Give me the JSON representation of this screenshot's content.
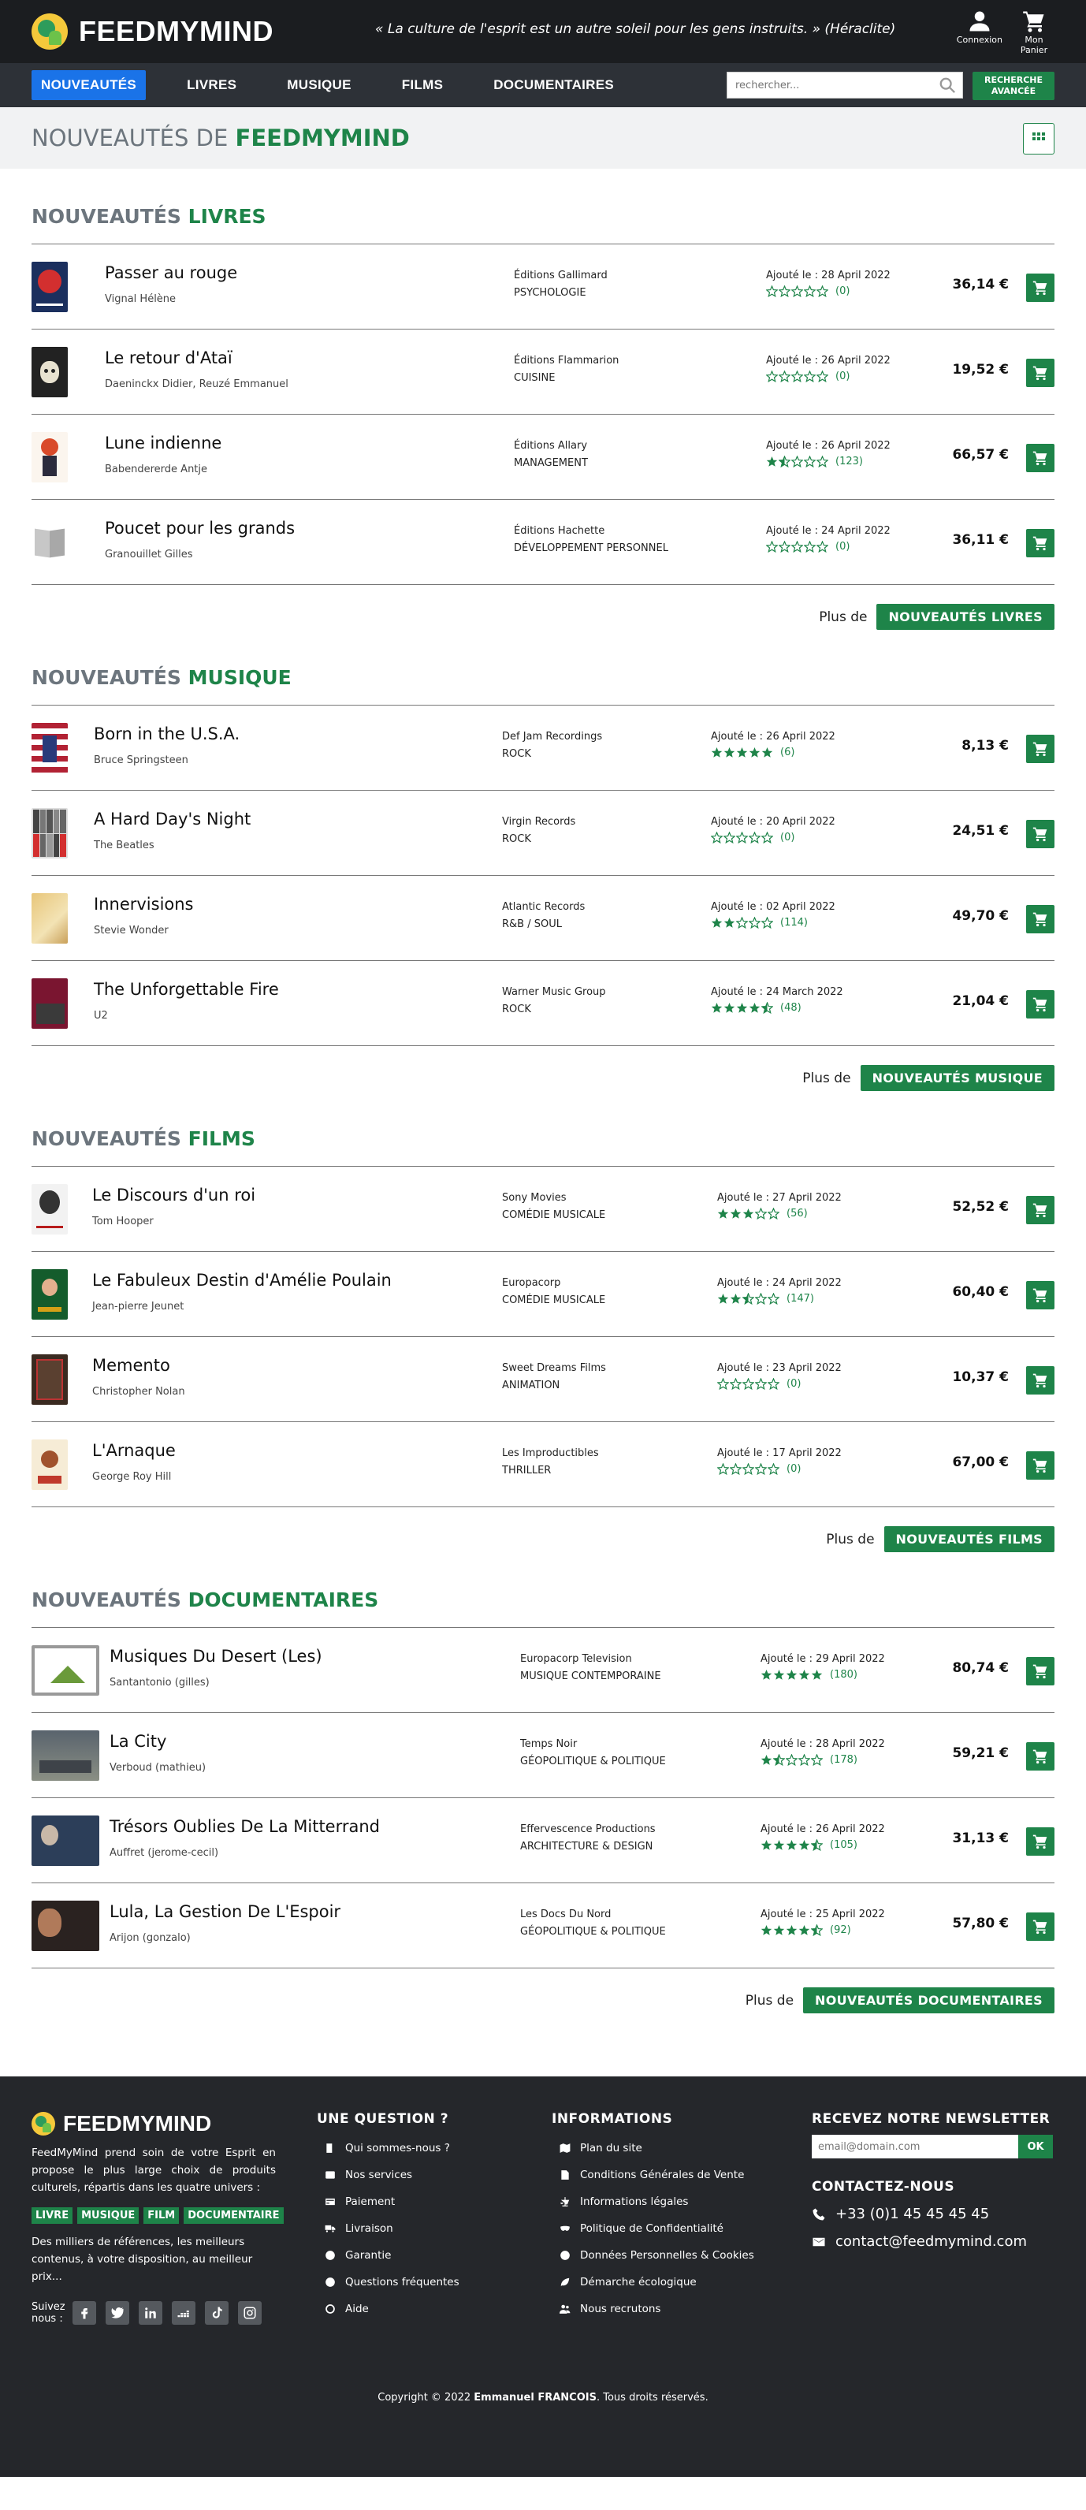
{
  "header": {
    "brand": "FEEDMYMIND",
    "quote": "« La culture de l'esprit est un autre soleil pour les gens instruits. » (Héraclite)",
    "login_label": "Connexion",
    "cart_label": "Mon Panier"
  },
  "nav": {
    "items": [
      {
        "label": "NOUVEAUTÉS",
        "active": true
      },
      {
        "label": "LIVRES"
      },
      {
        "label": "MUSIQUE"
      },
      {
        "label": "FILMS"
      },
      {
        "label": "DOCUMENTAIRES"
      }
    ],
    "search_placeholder": "rechercher...",
    "advanced_label": "RECHERCHE AVANCÉE"
  },
  "page": {
    "title_prefix": "NOUVEAUTÉS DE",
    "title_brand": "FEEDMYMIND"
  },
  "colors": {
    "accent": "#1e8449",
    "nav_active": "#1a73e8",
    "topbar": "#1b1d20"
  },
  "sections": [
    {
      "prefix": "NOUVEAUTÉS",
      "name": "LIVRES",
      "more_label": "Plus de",
      "more_button": "NOUVEAUTÉS LIVRES",
      "items": [
        {
          "title": "Passer au rouge",
          "author": "Vignal Hélène",
          "publisher": "Éditions Gallimard",
          "category": "PSYCHOLOGIE",
          "date": "Ajouté le : 28 April 2022",
          "rating": 0,
          "count": "(0)",
          "price": "36,14 €",
          "thumb": "book-red"
        },
        {
          "title": "Le retour d'Ataï",
          "author": "Daeninckx Didier, Reuzé Emmanuel",
          "publisher": "Éditions Flammarion",
          "category": "CUISINE",
          "date": "Ajouté le : 26 April 2022",
          "rating": 0,
          "count": "(0)",
          "price": "19,52 €",
          "thumb": "book-skull"
        },
        {
          "title": "Lune indienne",
          "author": "Babendererde Antje",
          "publisher": "Éditions Allary",
          "category": "MANAGEMENT",
          "date": "Ajouté le : 26 April 2022",
          "rating": 1.5,
          "count": "(123)",
          "price": "66,57 €",
          "thumb": "book-girl"
        },
        {
          "title": "Poucet pour les grands",
          "author": "Granouillet Gilles",
          "publisher": "Éditions Hachette",
          "category": "DÉVELOPPEMENT PERSONNEL",
          "date": "Ajouté le : 24 April 2022",
          "rating": 0,
          "count": "(0)",
          "price": "36,11 €",
          "thumb": "book-placeholder"
        }
      ]
    },
    {
      "prefix": "NOUVEAUTÉS",
      "name": "MUSIQUE",
      "more_label": "Plus de",
      "more_button": "NOUVEAUTÉS MUSIQUE",
      "items": [
        {
          "title": "Born in the U.S.A.",
          "author": "Bruce Springsteen",
          "publisher": "Def Jam Recordings",
          "category": "ROCK",
          "date": "Ajouté le : 26 April 2022",
          "rating": 5,
          "count": "(6)",
          "price": "8,13 €",
          "thumb": "album-usa"
        },
        {
          "title": "A Hard Day's Night",
          "author": "The Beatles",
          "publisher": "Virgin Records",
          "category": "ROCK",
          "date": "Ajouté le : 20 April 2022",
          "rating": 0,
          "count": "(0)",
          "price": "24,51 €",
          "thumb": "album-beatles"
        },
        {
          "title": "Innervisions",
          "author": "Stevie Wonder",
          "publisher": "Atlantic Records",
          "category": "R&B / SOUL",
          "date": "Ajouté le : 02 April 2022",
          "rating": 2,
          "count": "(114)",
          "price": "49,70 €",
          "thumb": "album-inner"
        },
        {
          "title": "The Unforgettable Fire",
          "author": "U2",
          "publisher": "Warner Music Group",
          "category": "ROCK",
          "date": "Ajouté le : 24 March 2022",
          "rating": 4.5,
          "count": "(48)",
          "price": "21,04 €",
          "thumb": "album-u2"
        }
      ]
    },
    {
      "prefix": "NOUVEAUTÉS",
      "name": "FILMS",
      "more_label": "Plus de",
      "more_button": "NOUVEAUTÉS FILMS",
      "items": [
        {
          "title": "Le Discours d'un roi",
          "author": "Tom Hooper",
          "publisher": "Sony Movies",
          "category": "COMÉDIE MUSICALE",
          "date": "Ajouté le : 27 April 2022",
          "rating": 3,
          "count": "(56)",
          "price": "52,52 €",
          "thumb": "film-roi"
        },
        {
          "title": "Le Fabuleux Destin d'Amélie Poulain",
          "author": "Jean-pierre Jeunet",
          "publisher": "Europacorp",
          "category": "COMÉDIE MUSICALE",
          "date": "Ajouté le : 24 April 2022",
          "rating": 2.5,
          "count": "(147)",
          "price": "60,40 €",
          "thumb": "film-amelie"
        },
        {
          "title": "Memento",
          "author": "Christopher Nolan",
          "publisher": "Sweet Dreams Films",
          "category": "ANIMATION",
          "date": "Ajouté le : 23 April 2022",
          "rating": 0,
          "count": "(0)",
          "price": "10,37 €",
          "thumb": "film-memento"
        },
        {
          "title": "L'Arnaque",
          "author": "George Roy Hill",
          "publisher": "Les Improductibles",
          "category": "THRILLER",
          "date": "Ajouté le : 17 April 2022",
          "rating": 0,
          "count": "(0)",
          "price": "67,00 €",
          "thumb": "film-arnaque"
        }
      ]
    },
    {
      "prefix": "NOUVEAUTÉS",
      "name": "DOCUMENTAIRES",
      "more_label": "Plus de",
      "more_button": "NOUVEAUTÉS DOCUMENTAIRES",
      "items": [
        {
          "title": "Musiques Du Desert (Les)",
          "author": "Santantonio (gilles)",
          "publisher": "Europacorp Television",
          "category": "MUSIQUE CONTEMPORAINE",
          "date": "Ajouté le : 29 April 2022",
          "rating": 5,
          "count": "(180)",
          "price": "80,74 €",
          "thumb": "doc-placeholder"
        },
        {
          "title": "La City",
          "author": "Verboud (mathieu)",
          "publisher": "Temps Noir",
          "category": "GÉOPOLITIQUE & POLITIQUE",
          "date": "Ajouté le : 28 April 2022",
          "rating": 1.5,
          "count": "(178)",
          "price": "59,21 €",
          "thumb": "doc-city"
        },
        {
          "title": "Trésors Oublies De La Mitterrand",
          "author": "Auffret (jerome-cecil)",
          "publisher": "Effervescence Productions",
          "category": "ARCHITECTURE & DESIGN",
          "date": "Ajouté le : 26 April 2022",
          "rating": 4.5,
          "count": "(105)",
          "price": "31,13 €",
          "thumb": "doc-mitterrand"
        },
        {
          "title": "Lula, La Gestion De L'Espoir",
          "author": "Arijon (gonzalo)",
          "publisher": "Les Docs Du Nord",
          "category": "GÉOPOLITIQUE & POLITIQUE",
          "date": "Ajouté le : 25 April 2022",
          "rating": 4.5,
          "count": "(92)",
          "price": "57,80 €",
          "thumb": "doc-lula"
        }
      ]
    }
  ],
  "footer": {
    "brand": "FEEDMYMIND",
    "description": "FeedMyMind prend soin de votre Esprit en propose le plus large choix de produits culturels, répartis dans les quatre univers :",
    "tags": [
      "LIVRE",
      "MUSIQUE",
      "FILM",
      "DOCUMENTAIRE"
    ],
    "description2": "Des milliers de références, les meilleurs contenus, à votre disposition, au meilleur prix...",
    "follow_label": "Suivez nous :",
    "socials": [
      "facebook-icon",
      "twitter-icon",
      "linkedin-icon",
      "deezer-icon",
      "tiktok-icon",
      "instagram-icon"
    ],
    "question_title": "UNE QUESTION ?",
    "question_links": [
      {
        "label": "Qui sommes-nous ?",
        "icon": "building-icon"
      },
      {
        "label": "Nos services",
        "icon": "bell-icon"
      },
      {
        "label": "Paiement",
        "icon": "credit-card-icon"
      },
      {
        "label": "Livraison",
        "icon": "truck-icon"
      },
      {
        "label": "Garantie",
        "icon": "shield-icon"
      },
      {
        "label": "Questions fréquentes",
        "icon": "question-icon"
      },
      {
        "label": "Aide",
        "icon": "help-icon"
      }
    ],
    "info_title": "INFORMATIONS",
    "info_links": [
      {
        "label": "Plan du site",
        "icon": "map-icon"
      },
      {
        "label": "Conditions Générales de Vente",
        "icon": "document-icon"
      },
      {
        "label": "Informations légales",
        "icon": "balance-icon"
      },
      {
        "label": "Politique de Confidentialité",
        "icon": "mask-icon"
      },
      {
        "label": "Données Personnelles & Cookies",
        "icon": "cookie-icon"
      },
      {
        "label": "Démarche écologique",
        "icon": "leaf-icon"
      },
      {
        "label": "Nous recrutons",
        "icon": "people-icon"
      }
    ],
    "newsletter_title": "RECEVEZ NOTRE NEWSLETTER",
    "newsletter_placeholder": "email@domain.com",
    "newsletter_button": "OK",
    "contact_title": "CONTACTEZ-NOUS",
    "phone": "+33 (0)1 45 45 45 45",
    "email": "contact@feedmymind.com",
    "copyright_prefix": "Copyright © 2022",
    "copyright_name": "Emmanuel FRANCOIS",
    "copyright_suffix": ". Tous droits réservés."
  }
}
